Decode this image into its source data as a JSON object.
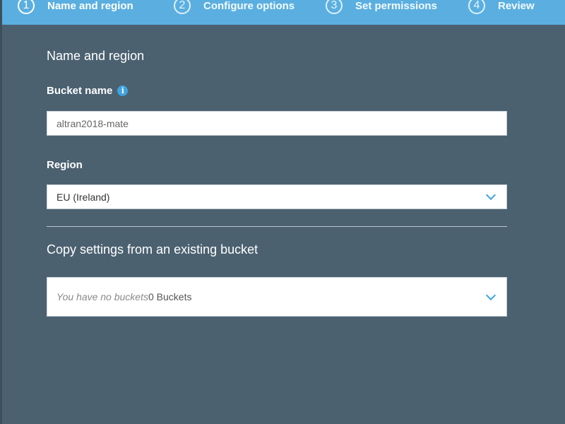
{
  "wizard": {
    "steps": [
      {
        "number": "1",
        "label": "Name and region"
      },
      {
        "number": "2",
        "label": "Configure options"
      },
      {
        "number": "3",
        "label": "Set permissions"
      },
      {
        "number": "4",
        "label": "Review"
      }
    ],
    "active_step": 1
  },
  "form": {
    "section_title": "Name and region",
    "bucket_name_label": "Bucket name",
    "bucket_name_value": "altran2018-mate",
    "region_label": "Region",
    "region_value": "EU (Ireland)",
    "copy_settings_title": "Copy settings from an existing bucket",
    "copy_placeholder": "You have no buckets",
    "copy_count": "0 Buckets"
  },
  "icons": {
    "info": "info-icon",
    "dropdown": "chevron-down-icon"
  },
  "colors": {
    "header": "#5aafe0",
    "panel": "#4b6170",
    "accent": "#3fa3e0"
  }
}
